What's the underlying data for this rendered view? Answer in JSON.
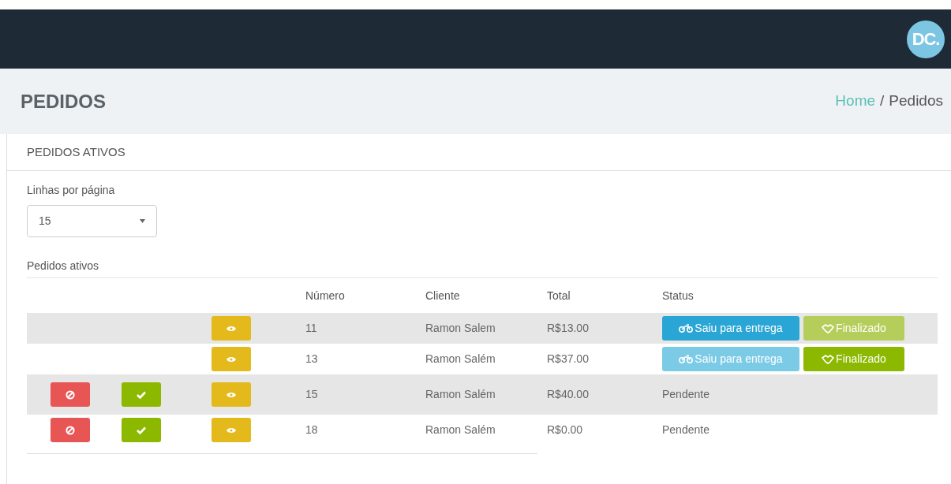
{
  "header": {
    "logo": "DC."
  },
  "page": {
    "title": "PEDIDOS",
    "breadcrumb": [
      {
        "kind": "link",
        "label": "Home"
      },
      {
        "kind": "separator",
        "label": "/"
      },
      {
        "kind": "current",
        "label": "Pedidos"
      }
    ]
  },
  "card": {
    "title": "PEDIDOS ATIVOS",
    "rows_per_page": {
      "label": "Linhas por página",
      "value": "15"
    },
    "table_caption": "Pedidos ativos",
    "columns": [
      "Número",
      "Cliente",
      "Total",
      "Status"
    ],
    "rows": [
      {
        "decision_buttons": false,
        "numero": "11",
        "cliente": "Ramon Salem",
        "total": "R$13.00",
        "status": {
          "kind": "buttons",
          "buttons": [
            {
              "kind": "delivery",
              "label": "Saiu para entrega",
              "disabled": false
            },
            {
              "kind": "done",
              "label": "Finalizado",
              "disabled": true
            }
          ]
        }
      },
      {
        "decision_buttons": false,
        "numero": "13",
        "cliente": "Ramon Salém",
        "total": "R$37.00",
        "status": {
          "kind": "buttons",
          "buttons": [
            {
              "kind": "delivery",
              "label": "Saiu para entrega",
              "disabled": true
            },
            {
              "kind": "done",
              "label": "Finalizado",
              "disabled": false
            }
          ]
        }
      },
      {
        "decision_buttons": true,
        "numero": "15",
        "cliente": "Ramon Salém",
        "total": "R$40.00",
        "status": {
          "kind": "text",
          "text": "Pendente"
        }
      },
      {
        "decision_buttons": true,
        "numero": "18",
        "cliente": "Ramon Salém",
        "total": "R$0.00",
        "status": {
          "kind": "text",
          "text": "Pendente"
        }
      }
    ]
  }
}
